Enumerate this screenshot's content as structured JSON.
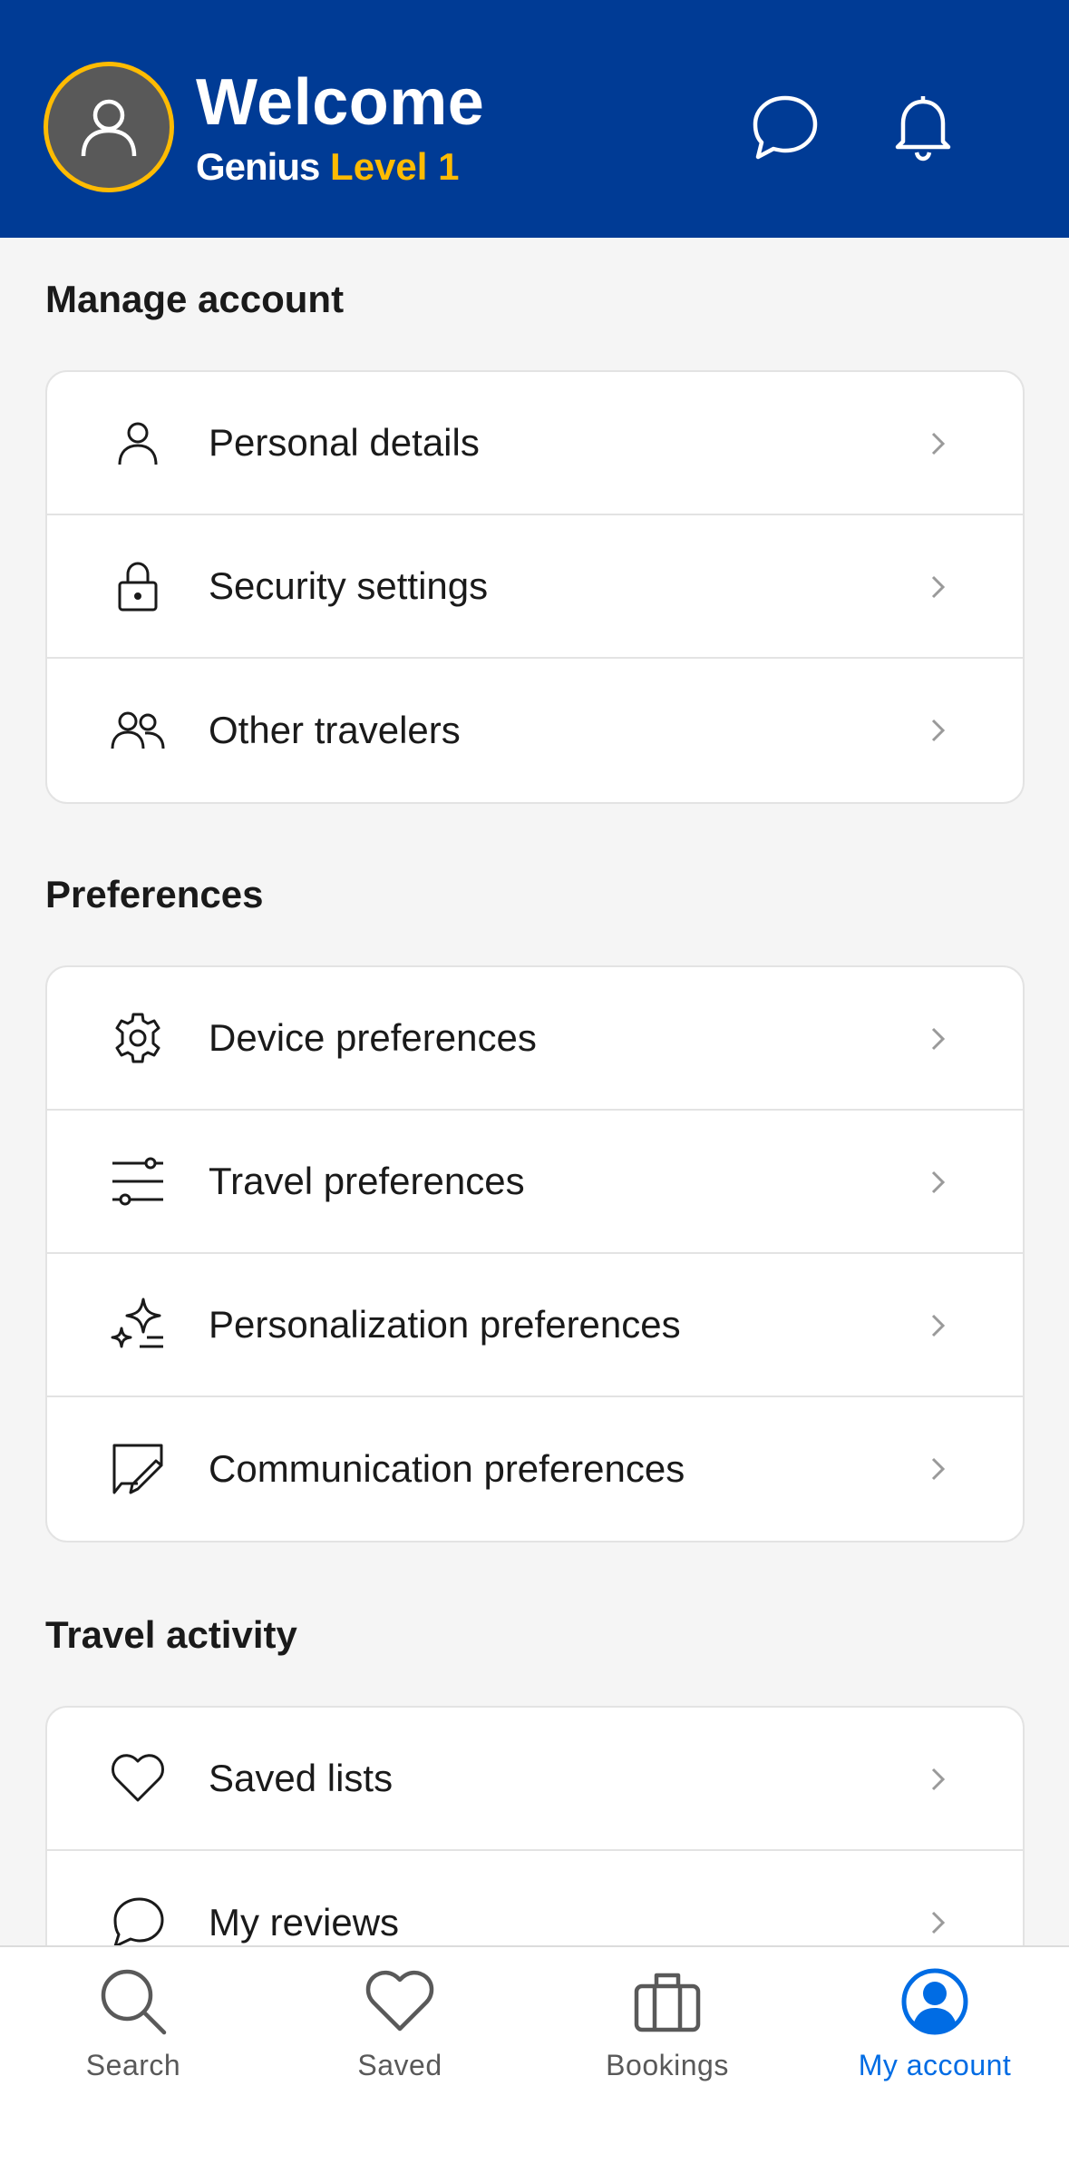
{
  "header": {
    "title": "Welcome",
    "genius_label": "Genius",
    "level_label": "Level 1",
    "chat_icon": "chat-bubble-icon",
    "bell_icon": "bell-icon"
  },
  "sections": [
    {
      "title": "Manage account",
      "items": [
        {
          "label": "Personal details",
          "icon": "person-icon"
        },
        {
          "label": "Security settings",
          "icon": "lock-icon"
        },
        {
          "label": "Other travelers",
          "icon": "people-icon"
        }
      ]
    },
    {
      "title": "Preferences",
      "items": [
        {
          "label": "Device preferences",
          "icon": "gear-icon"
        },
        {
          "label": "Travel preferences",
          "icon": "sliders-icon"
        },
        {
          "label": "Personalization preferences",
          "icon": "sparkle-icon"
        },
        {
          "label": "Communication preferences",
          "icon": "message-edit-icon"
        }
      ]
    },
    {
      "title": "Travel activity",
      "items": [
        {
          "label": "Saved lists",
          "icon": "heart-icon"
        },
        {
          "label": "My reviews",
          "icon": "chat-bubble-icon"
        }
      ]
    }
  ],
  "tabbar": {
    "tabs": [
      {
        "label": "Search",
        "icon": "search-icon",
        "active": false
      },
      {
        "label": "Saved",
        "icon": "heart-icon",
        "active": false
      },
      {
        "label": "Bookings",
        "icon": "suitcase-icon",
        "active": false
      },
      {
        "label": "My account",
        "icon": "account-icon",
        "active": true
      }
    ]
  },
  "colors": {
    "brand_blue": "#003b95",
    "genius_yellow": "#febb02",
    "active_tab": "#006ce4",
    "background": "#f5f5f5"
  }
}
